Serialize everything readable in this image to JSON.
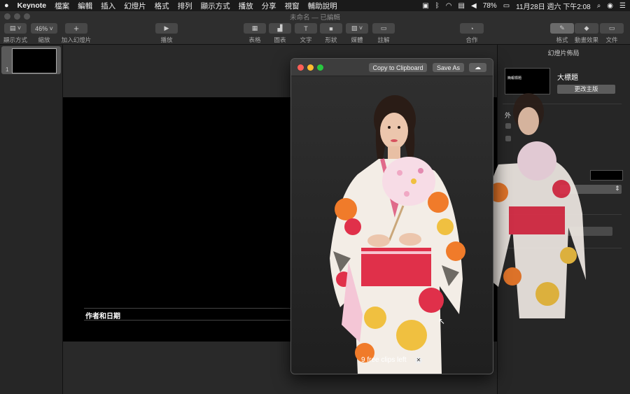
{
  "menubar": {
    "apple": "",
    "items": [
      "Keynote",
      "檔案",
      "編輯",
      "插入",
      "幻燈片",
      "格式",
      "排列",
      "顯示方式",
      "播放",
      "分享",
      "視窗",
      "輔助說明"
    ],
    "status": {
      "battery": "78%",
      "datetime": "11月28日 週六 下午2:08"
    }
  },
  "window": {
    "title": "未命名 — 已編輯"
  },
  "toolbar": {
    "view_label": "顯示方式",
    "zoom_value": "46%",
    "zoom_label": "縮放",
    "add_slide_label": "加入幻燈片",
    "play_label": "播放",
    "table_label": "表格",
    "chart_label": "圖表",
    "text_label": "文字",
    "shape_label": "形狀",
    "media_label": "媒體",
    "comment_label": "註解",
    "collaborate_label": "合作",
    "format_label": "格式",
    "animate_label": "動畫效果",
    "document_label": "文件"
  },
  "navigator": {
    "slide_number": "1"
  },
  "slide": {
    "author_placeholder": "作者和日期"
  },
  "inspector": {
    "title": "幻燈片佈局",
    "layout_name": "大標題",
    "change_master_button": "更改主版",
    "thumb_text": "簡報標題",
    "section_label": "外"
  },
  "clip_window": {
    "copy_button": "Copy to Clipboard",
    "save_button": "Save As",
    "clips_left": "9 free clips left"
  },
  "colors": {
    "accent": "#f0c040",
    "kimono_red": "#e0304a",
    "kimono_orange": "#f07b2a"
  }
}
